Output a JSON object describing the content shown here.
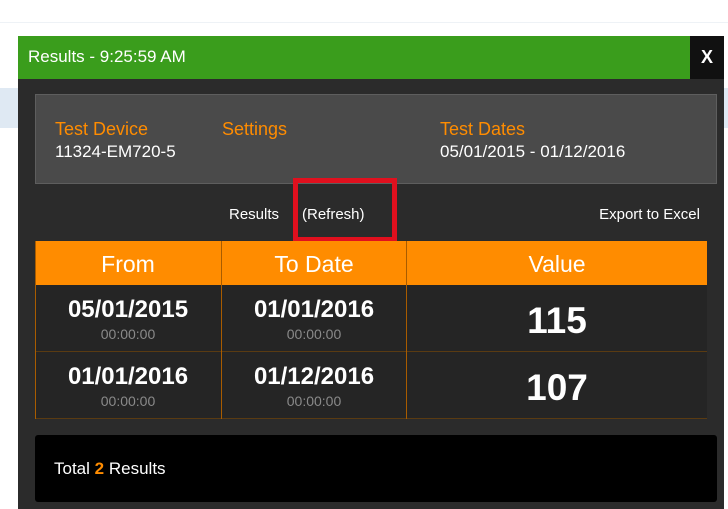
{
  "dialog": {
    "title": "Results - 9:25:59 AM",
    "close_label": "X"
  },
  "info": {
    "device_label": "Test Device",
    "device_value": "11324-EM720-5",
    "settings_label": "Settings",
    "dates_label": "Test Dates",
    "dates_value": "05/01/2015 - 01/12/2016"
  },
  "toolbar": {
    "results_label": "Results",
    "refresh_label": "(Refresh)",
    "export_label": "Export to Excel"
  },
  "table": {
    "headers": [
      "From",
      "To Date",
      "Value"
    ],
    "rows": [
      {
        "from_date": "05/01/2015",
        "from_time": "00:00:00",
        "to_date": "01/01/2016",
        "to_time": "00:00:00",
        "value": "115"
      },
      {
        "from_date": "01/01/2016",
        "from_time": "00:00:00",
        "to_date": "01/12/2016",
        "to_time": "00:00:00",
        "value": "107"
      }
    ]
  },
  "footer": {
    "prefix": "Total",
    "count": "2",
    "suffix": "Results"
  },
  "colors": {
    "titlebar": "#3a9d1c",
    "accent": "#ff8c00",
    "highlight": "#e0101e"
  }
}
